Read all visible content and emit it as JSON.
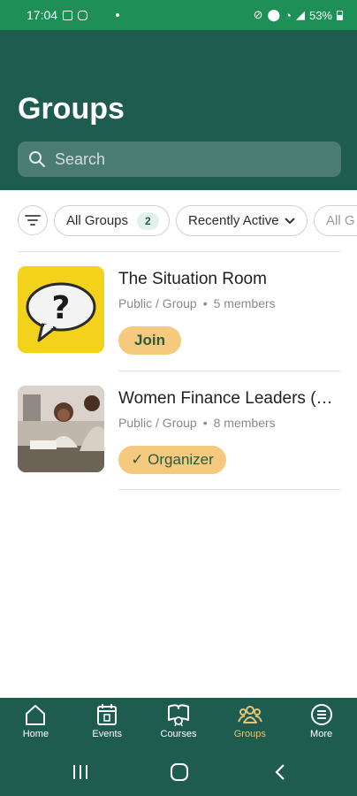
{
  "status_bar": {
    "time": "17:04",
    "battery": "53%"
  },
  "header": {
    "title": "Groups",
    "search_placeholder": "Search"
  },
  "filters": {
    "chips": [
      {
        "label": "All Groups",
        "count": "2"
      },
      {
        "label": "Recently Active"
      },
      {
        "label": "All G"
      }
    ]
  },
  "groups": [
    {
      "name": "The Situation Room",
      "type": "Public / Group",
      "separator": "•",
      "members": "5 members",
      "action": "Join"
    },
    {
      "name": "Women Finance Leaders (W...",
      "type": "Public / Group",
      "separator": "•",
      "members": "8 members",
      "action": "✓ Organizer"
    }
  ],
  "bottom_nav": {
    "items": [
      {
        "label": "Home",
        "icon": "home-icon"
      },
      {
        "label": "Events",
        "icon": "calendar-icon"
      },
      {
        "label": "Courses",
        "icon": "courses-icon"
      },
      {
        "label": "Groups",
        "icon": "groups-icon",
        "active": true
      },
      {
        "label": "More",
        "icon": "more-icon"
      }
    ]
  },
  "colors": {
    "status_bar": "#1e8f57",
    "header": "#1f5c50",
    "accent": "#f5c97e",
    "active_nav": "#e8c278"
  }
}
